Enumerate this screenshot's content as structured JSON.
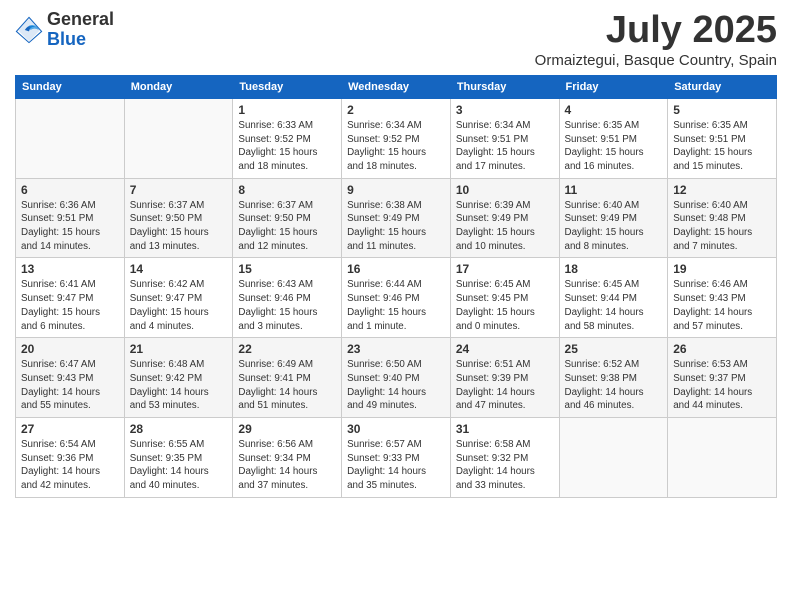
{
  "header": {
    "logo_general": "General",
    "logo_blue": "Blue",
    "month_title": "July 2025",
    "location": "Ormaiztegui, Basque Country, Spain"
  },
  "days_of_week": [
    "Sunday",
    "Monday",
    "Tuesday",
    "Wednesday",
    "Thursday",
    "Friday",
    "Saturday"
  ],
  "weeks": [
    [
      {
        "day": "",
        "info": ""
      },
      {
        "day": "",
        "info": ""
      },
      {
        "day": "1",
        "info": "Sunrise: 6:33 AM\nSunset: 9:52 PM\nDaylight: 15 hours and 18 minutes."
      },
      {
        "day": "2",
        "info": "Sunrise: 6:34 AM\nSunset: 9:52 PM\nDaylight: 15 hours and 18 minutes."
      },
      {
        "day": "3",
        "info": "Sunrise: 6:34 AM\nSunset: 9:51 PM\nDaylight: 15 hours and 17 minutes."
      },
      {
        "day": "4",
        "info": "Sunrise: 6:35 AM\nSunset: 9:51 PM\nDaylight: 15 hours and 16 minutes."
      },
      {
        "day": "5",
        "info": "Sunrise: 6:35 AM\nSunset: 9:51 PM\nDaylight: 15 hours and 15 minutes."
      }
    ],
    [
      {
        "day": "6",
        "info": "Sunrise: 6:36 AM\nSunset: 9:51 PM\nDaylight: 15 hours and 14 minutes."
      },
      {
        "day": "7",
        "info": "Sunrise: 6:37 AM\nSunset: 9:50 PM\nDaylight: 15 hours and 13 minutes."
      },
      {
        "day": "8",
        "info": "Sunrise: 6:37 AM\nSunset: 9:50 PM\nDaylight: 15 hours and 12 minutes."
      },
      {
        "day": "9",
        "info": "Sunrise: 6:38 AM\nSunset: 9:49 PM\nDaylight: 15 hours and 11 minutes."
      },
      {
        "day": "10",
        "info": "Sunrise: 6:39 AM\nSunset: 9:49 PM\nDaylight: 15 hours and 10 minutes."
      },
      {
        "day": "11",
        "info": "Sunrise: 6:40 AM\nSunset: 9:49 PM\nDaylight: 15 hours and 8 minutes."
      },
      {
        "day": "12",
        "info": "Sunrise: 6:40 AM\nSunset: 9:48 PM\nDaylight: 15 hours and 7 minutes."
      }
    ],
    [
      {
        "day": "13",
        "info": "Sunrise: 6:41 AM\nSunset: 9:47 PM\nDaylight: 15 hours and 6 minutes."
      },
      {
        "day": "14",
        "info": "Sunrise: 6:42 AM\nSunset: 9:47 PM\nDaylight: 15 hours and 4 minutes."
      },
      {
        "day": "15",
        "info": "Sunrise: 6:43 AM\nSunset: 9:46 PM\nDaylight: 15 hours and 3 minutes."
      },
      {
        "day": "16",
        "info": "Sunrise: 6:44 AM\nSunset: 9:46 PM\nDaylight: 15 hours and 1 minute."
      },
      {
        "day": "17",
        "info": "Sunrise: 6:45 AM\nSunset: 9:45 PM\nDaylight: 15 hours and 0 minutes."
      },
      {
        "day": "18",
        "info": "Sunrise: 6:45 AM\nSunset: 9:44 PM\nDaylight: 14 hours and 58 minutes."
      },
      {
        "day": "19",
        "info": "Sunrise: 6:46 AM\nSunset: 9:43 PM\nDaylight: 14 hours and 57 minutes."
      }
    ],
    [
      {
        "day": "20",
        "info": "Sunrise: 6:47 AM\nSunset: 9:43 PM\nDaylight: 14 hours and 55 minutes."
      },
      {
        "day": "21",
        "info": "Sunrise: 6:48 AM\nSunset: 9:42 PM\nDaylight: 14 hours and 53 minutes."
      },
      {
        "day": "22",
        "info": "Sunrise: 6:49 AM\nSunset: 9:41 PM\nDaylight: 14 hours and 51 minutes."
      },
      {
        "day": "23",
        "info": "Sunrise: 6:50 AM\nSunset: 9:40 PM\nDaylight: 14 hours and 49 minutes."
      },
      {
        "day": "24",
        "info": "Sunrise: 6:51 AM\nSunset: 9:39 PM\nDaylight: 14 hours and 47 minutes."
      },
      {
        "day": "25",
        "info": "Sunrise: 6:52 AM\nSunset: 9:38 PM\nDaylight: 14 hours and 46 minutes."
      },
      {
        "day": "26",
        "info": "Sunrise: 6:53 AM\nSunset: 9:37 PM\nDaylight: 14 hours and 44 minutes."
      }
    ],
    [
      {
        "day": "27",
        "info": "Sunrise: 6:54 AM\nSunset: 9:36 PM\nDaylight: 14 hours and 42 minutes."
      },
      {
        "day": "28",
        "info": "Sunrise: 6:55 AM\nSunset: 9:35 PM\nDaylight: 14 hours and 40 minutes."
      },
      {
        "day": "29",
        "info": "Sunrise: 6:56 AM\nSunset: 9:34 PM\nDaylight: 14 hours and 37 minutes."
      },
      {
        "day": "30",
        "info": "Sunrise: 6:57 AM\nSunset: 9:33 PM\nDaylight: 14 hours and 35 minutes."
      },
      {
        "day": "31",
        "info": "Sunrise: 6:58 AM\nSunset: 9:32 PM\nDaylight: 14 hours and 33 minutes."
      },
      {
        "day": "",
        "info": ""
      },
      {
        "day": "",
        "info": ""
      }
    ]
  ]
}
